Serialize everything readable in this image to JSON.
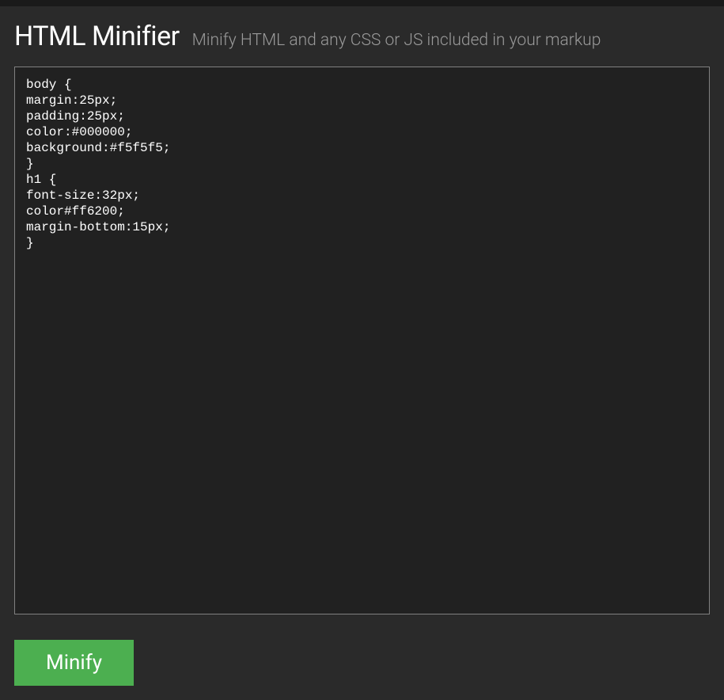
{
  "header": {
    "title": "HTML Minifier",
    "subtitle": "Minify HTML and any CSS or JS included in your markup"
  },
  "editor": {
    "value": "body {\nmargin:25px;\npadding:25px;\ncolor:#000000;\nbackground:#f5f5f5;\n}\nh1 {\nfont-size:32px;\ncolor#ff6200;\nmargin-bottom:15px;\n}"
  },
  "actions": {
    "minify_label": "Minify"
  }
}
